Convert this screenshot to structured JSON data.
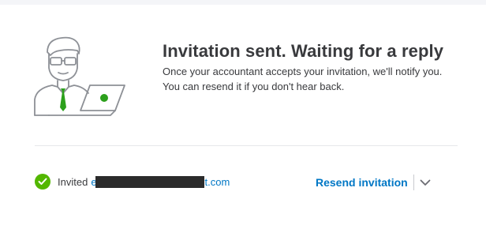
{
  "headline": "Invitation sent. Waiting for a reply",
  "description": {
    "line1": "Once your accountant accepts your invitation, we'll notify you.",
    "line2": "You can resend it if you don't hear back."
  },
  "invite": {
    "label": "Invited",
    "email_prefix": "e",
    "email_suffix": "t.com",
    "status_icon": "check-circle-icon"
  },
  "actions": {
    "resend_label": "Resend invitation",
    "dropdown_icon": "chevron-down-icon"
  },
  "colors": {
    "text": "#393a3d",
    "link": "#0077c5",
    "success": "#53b700",
    "tie": "#2ca01c"
  }
}
